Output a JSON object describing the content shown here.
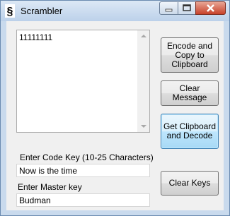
{
  "window": {
    "title": "Scrambler"
  },
  "message": {
    "value": "11111111"
  },
  "code_key": {
    "label": "Enter Code Key (10-25 Characters)",
    "value": "Now is the time"
  },
  "master_key": {
    "label": "Enter Master key",
    "value": "Budman"
  },
  "buttons": {
    "encode": "Encode and Copy to Clipboard",
    "clear_message": "Clear Message",
    "decode": "Get Clipboard and Decode",
    "clear_keys": "Clear Keys"
  }
}
